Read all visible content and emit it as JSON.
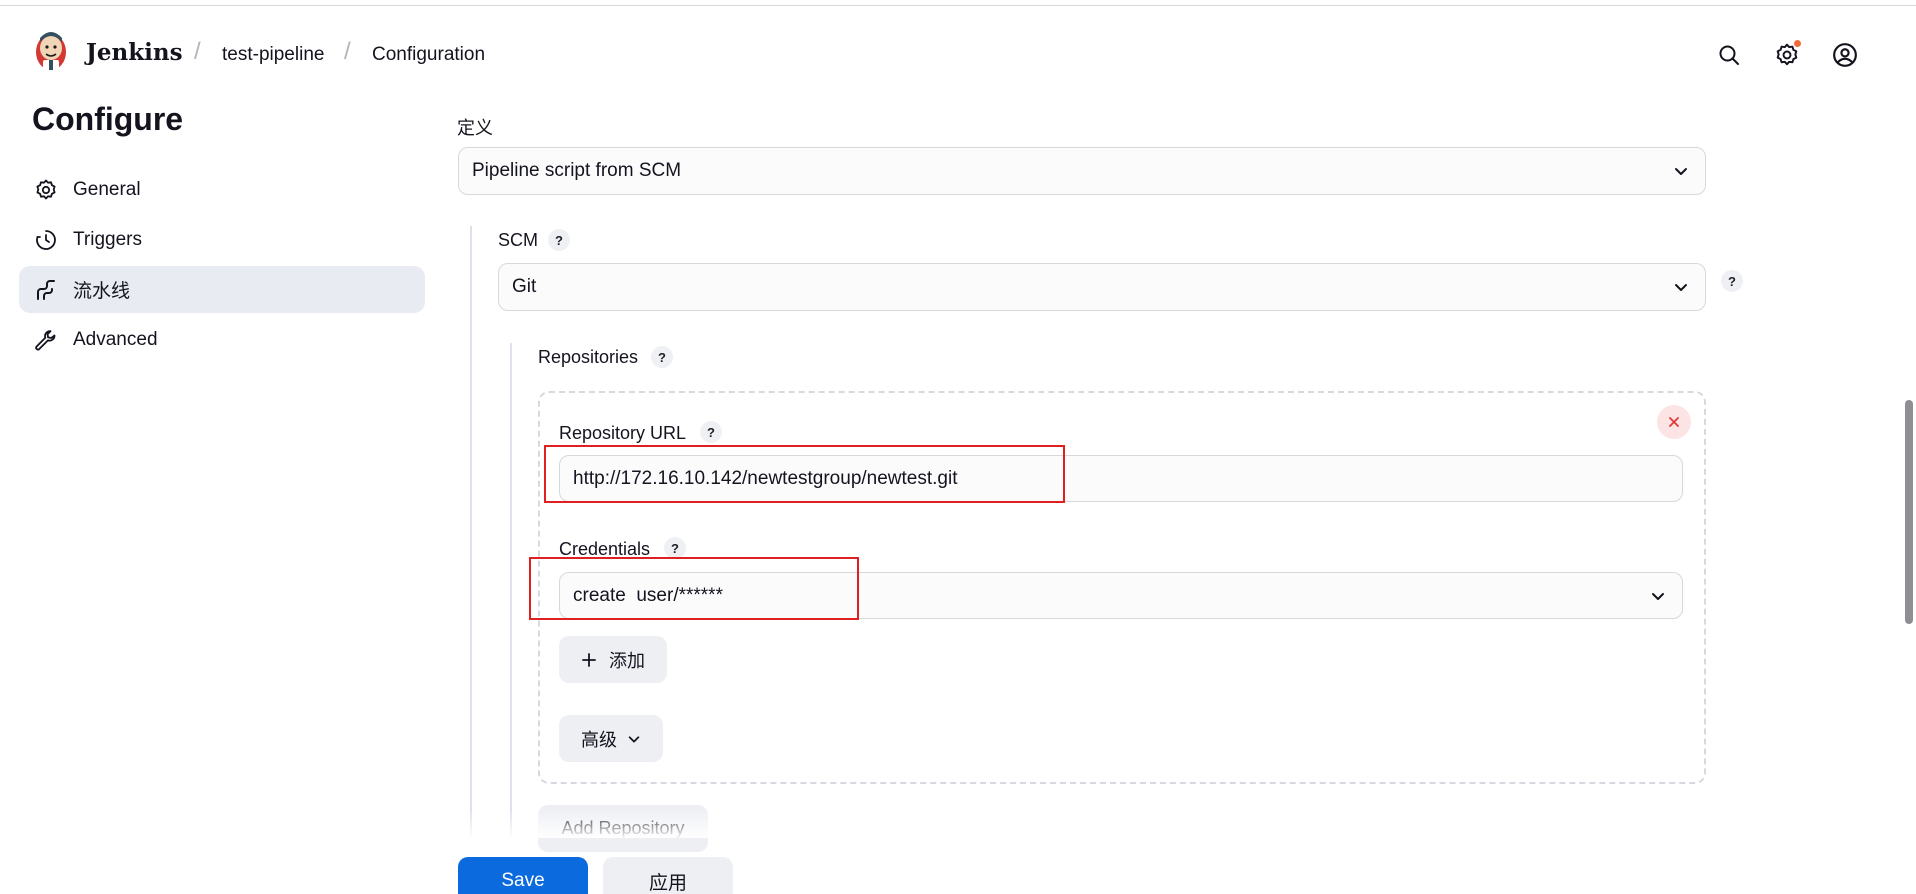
{
  "header": {
    "brand": "Jenkins",
    "breadcrumbs": [
      "test-pipeline",
      "Configuration"
    ],
    "icons": [
      "search-icon",
      "settings-icon",
      "user-icon"
    ]
  },
  "sidebar": {
    "title": "Configure",
    "items": [
      {
        "label": "General",
        "icon": "gear-icon",
        "active": false
      },
      {
        "label": "Triggers",
        "icon": "clock-icon",
        "active": false
      },
      {
        "label": "流水线",
        "icon": "pipeline-icon",
        "active": true
      },
      {
        "label": "Advanced",
        "icon": "wrench-icon",
        "active": false
      }
    ]
  },
  "form": {
    "definition_label": "定义",
    "definition_value": "Pipeline script from SCM",
    "scm_label": "SCM",
    "scm_value": "Git",
    "help_glyph": "?",
    "repositories_label": "Repositories",
    "repo_url_label": "Repository URL",
    "repo_url_value": "http://172.16.10.142/newtestgroup/newtest.git",
    "credentials_label": "Credentials",
    "credentials_value": "create  user/******",
    "add_label": "添加",
    "advanced_label": "高级",
    "add_repository_label": "Add Repository"
  },
  "footer": {
    "save_label": "Save",
    "apply_label": "应用"
  },
  "colors": {
    "primary": "#0b6bde",
    "highlight": "#e02020",
    "active_bg": "#e8ebf1"
  }
}
